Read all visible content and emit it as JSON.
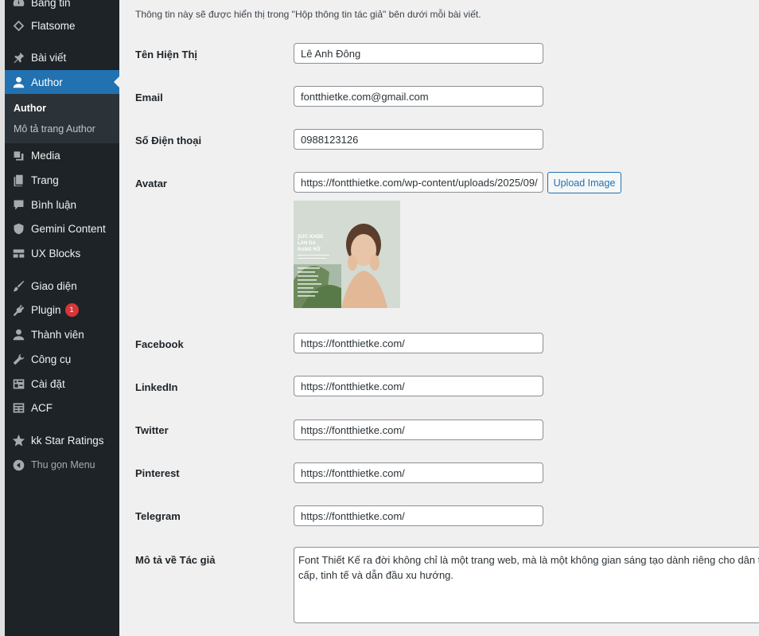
{
  "sidebar": {
    "items": [
      {
        "label": "Bảng tin",
        "icon": "dashboard-icon"
      },
      {
        "label": "Flatsome",
        "icon": "flatsome-icon"
      },
      {
        "label": "Bài viết",
        "icon": "pin-icon"
      },
      {
        "label": "Author",
        "icon": "user-icon"
      },
      {
        "label": "Media",
        "icon": "media-icon"
      },
      {
        "label": "Trang",
        "icon": "page-icon"
      },
      {
        "label": "Bình luận",
        "icon": "comment-icon"
      },
      {
        "label": "Gemini Content",
        "icon": "shield-icon"
      },
      {
        "label": "UX Blocks",
        "icon": "blocks-icon"
      },
      {
        "label": "Giao diện",
        "icon": "brush-icon"
      },
      {
        "label": "Plugin",
        "icon": "plugin-icon",
        "badge": "1"
      },
      {
        "label": "Thành viên",
        "icon": "user-icon"
      },
      {
        "label": "Công cụ",
        "icon": "wrench-icon"
      },
      {
        "label": "Cài đặt",
        "icon": "settings-icon"
      },
      {
        "label": "ACF",
        "icon": "acf-icon"
      },
      {
        "label": "kk Star Ratings",
        "icon": "star-icon"
      }
    ],
    "submenu": [
      "Author",
      "Mô tả trang Author"
    ],
    "collapse": "Thu gọn Menu"
  },
  "form": {
    "note": "Thông tin này sẽ được hiển thị trong \"Hộp thông tin tác giả\" bên dưới mỗi bài viết.",
    "display_name": {
      "label": "Tên Hiện Thị",
      "value": "Lê Anh Đông"
    },
    "email": {
      "label": "Email",
      "value": "fontthietke.com@gmail.com"
    },
    "phone": {
      "label": "Số Điện thoại",
      "value": "0988123126"
    },
    "avatar": {
      "label": "Avatar",
      "value": "https://fontthietke.com/wp-content/uploads/2025/09/",
      "upload_label": "Upload Image",
      "image_text": [
        "SỨC KHỎE",
        "LÀN DA",
        "RẠNG RỠ"
      ]
    },
    "facebook": {
      "label": "Facebook",
      "value": "https://fontthietke.com/"
    },
    "linkedin": {
      "label": "LinkedIn",
      "value": "https://fontthietke.com/"
    },
    "twitter": {
      "label": "Twitter",
      "value": "https://fontthietke.com/"
    },
    "pinterest": {
      "label": "Pinterest",
      "value": "https://fontthietke.com/"
    },
    "telegram": {
      "label": "Telegram",
      "value": "https://fontthietke.com/"
    },
    "description": {
      "label": "Mô tả về Tác giả",
      "line1": "Font Thiết Kế ra đời không chỉ là một trang web, mà là một không gian sáng tạo dành riêng cho dân thiế",
      "line2": "cấp, tinh tế và dẫn đầu xu hướng."
    }
  }
}
